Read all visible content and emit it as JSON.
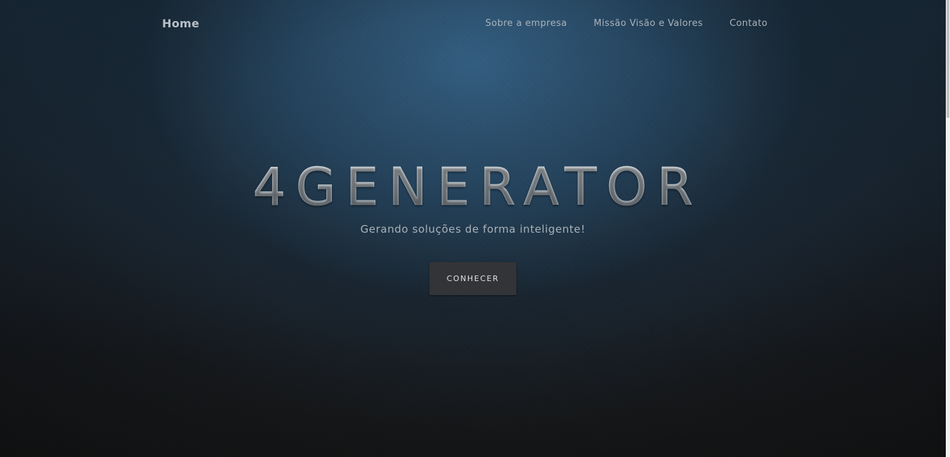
{
  "nav": {
    "brand": "Home",
    "links": [
      {
        "label": "Sobre a empresa"
      },
      {
        "label": "Missão Visão e Valores"
      },
      {
        "label": "Contato"
      }
    ]
  },
  "hero": {
    "title": "4GENERATOR",
    "subtitle": "Gerando soluções de forma inteligente!",
    "cta_label": "CONHECER"
  },
  "colors": {
    "background_top": "#2f5676",
    "background_bottom": "#161718",
    "button_bg": "#333437",
    "text_muted": "#aab3ba"
  }
}
